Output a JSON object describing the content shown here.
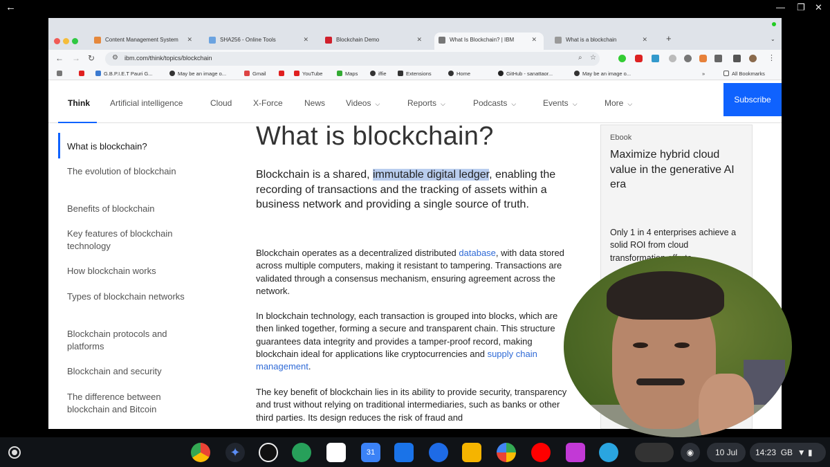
{
  "browser": {
    "tabs": [
      {
        "label": "Content Management System",
        "color": "#e5883c"
      },
      {
        "label": "SHA256 - Online Tools",
        "color": "#6ba3e0"
      },
      {
        "label": "Blockchain Demo",
        "color": "#d0202c"
      },
      {
        "label": "What Is Blockchain? | IBM",
        "color": "#777777"
      },
      {
        "label": "What is a blockchain",
        "color": "#999999"
      }
    ],
    "url": "ibm.com/think/topics/blockchain",
    "bookmarks": [
      "G.B.P.I.E.T Pauri G...",
      "May be an image o...",
      "Gmail",
      "YouTube",
      "Maps",
      "iffie",
      "Extensions",
      "Home",
      "GitHub - sanattaor...",
      "May be an image o..."
    ],
    "all_bookmarks": "All Bookmarks"
  },
  "site_nav": {
    "items": [
      {
        "label": "Think",
        "dropdown": false
      },
      {
        "label": "Artificial intelligence",
        "dropdown": false
      },
      {
        "label": "Cloud",
        "dropdown": false
      },
      {
        "label": "X-Force",
        "dropdown": false
      },
      {
        "label": "News",
        "dropdown": false
      },
      {
        "label": "Videos",
        "dropdown": true
      },
      {
        "label": "Reports",
        "dropdown": true
      },
      {
        "label": "Podcasts",
        "dropdown": true
      },
      {
        "label": "Events",
        "dropdown": true
      },
      {
        "label": "More",
        "dropdown": true
      }
    ],
    "subscribe": "Subscribe"
  },
  "toc": [
    "What is blockchain?",
    "The evolution of blockchain",
    "Benefits of blockchain",
    "Key features of blockchain technology",
    "How blockchain works",
    "Types of blockchain networks",
    "Blockchain protocols and platforms",
    "Blockchain and security",
    "The difference between blockchain and Bitcoin"
  ],
  "article": {
    "title": "What is blockchain?",
    "lead_pre": "Blockchain is a shared, ",
    "lead_highlight": "immutable digital ledger",
    "lead_post": ", enabling the recording of transactions and the tracking of assets within a business network and providing a single source of truth.",
    "p1_pre": "Blockchain operates as a decentralized distributed ",
    "p1_link": "database",
    "p1_post": ", with data stored across multiple computers, making it resistant to tampering. Transactions are validated through a consensus mechanism, ensuring agreement across the network.",
    "p2_pre": "In blockchain technology, each transaction is grouped into blocks, which are then linked together, forming a secure and transparent chain. This structure guarantees data integrity and provides a tamper-proof record, making blockchain ideal for applications like cryptocurrencies and ",
    "p2_link": "supply chain management",
    "p2_post": ".",
    "p3": "The key benefit of blockchain lies in its ability to provide security, transparency and trust without relying on traditional intermediaries, such as banks or other third parties. Its design reduces the risk of fraud and"
  },
  "ebook": {
    "tag": "Ebook",
    "title": "Maximize hybrid cloud value in the generative AI era",
    "desc": "Only 1 in 4 enterprises achieve a solid ROI from cloud transformation efforts"
  },
  "taskbar": {
    "date": "10 Jul",
    "time": "14:23",
    "locale": "GB"
  }
}
